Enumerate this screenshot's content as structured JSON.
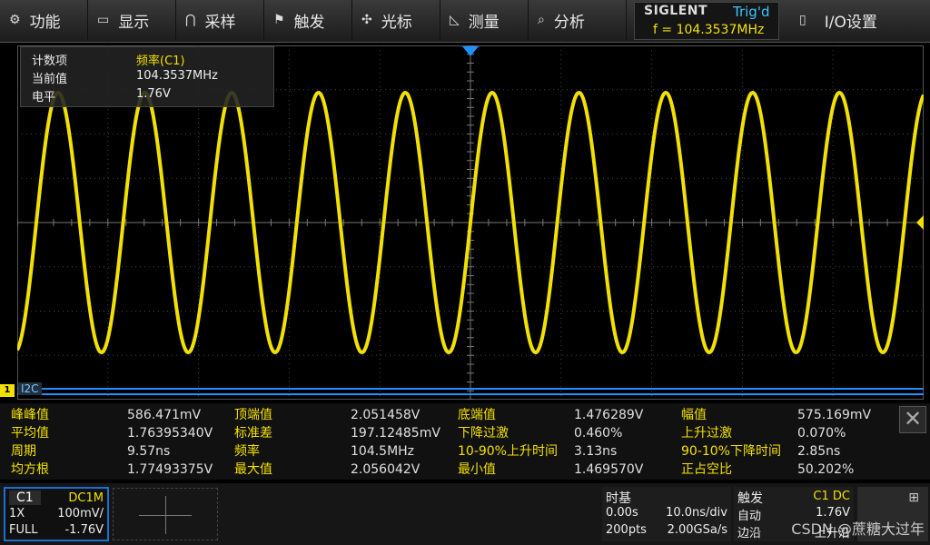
{
  "menu": {
    "func": "功能",
    "display": "显示",
    "acquire": "采样",
    "trigger": "触发",
    "cursor": "光标",
    "measure": "测量",
    "analysis": "分析",
    "io": "I/O设置"
  },
  "brand": {
    "logo": "SIGLENT",
    "trig_status": "Trig'd",
    "freq": "f = 104.3537MHz"
  },
  "counter": {
    "label1": "计数项",
    "value1": "频率(C1)",
    "label2": "当前值",
    "value2": "104.3537MHz",
    "label3": "电平",
    "value3": "1.76V"
  },
  "channel_marker": "1",
  "bus_label": "I2C",
  "measurements": [
    [
      "峰峰值",
      "586.471mV",
      "顶端值",
      "2.051458V",
      "底端值",
      "1.476289V",
      "幅值",
      "575.169mV"
    ],
    [
      "平均值",
      "1.76395340V",
      "标准差",
      "197.12485mV",
      "下降过激",
      "0.460%",
      "上升过激",
      "0.070%"
    ],
    [
      "周期",
      "9.57ns",
      "频率",
      "104.5MHz",
      "10-90%上升时间",
      "3.13ns",
      "90-10%下降时间",
      "2.85ns"
    ],
    [
      "均方根",
      "1.77493375V",
      "最大值",
      "2.056042V",
      "最小值",
      "1.469570V",
      "正占空比",
      "50.202%"
    ]
  ],
  "channel": {
    "name": "C1",
    "coupling": "DC1M",
    "probe": "1X",
    "scale": "100mV/",
    "bw": "FULL",
    "offset": "-1.76V"
  },
  "timebase": {
    "title": "时基",
    "delay": "0.00s",
    "scale": "10.0ns/div",
    "points": "200pts",
    "rate": "2.00GSa/s"
  },
  "trigger": {
    "title": "触发",
    "source": "C1 DC",
    "mode": "自动",
    "level": "1.76V",
    "type": "边沿",
    "slope": "上升沿"
  },
  "watermark": "CSDN @蔗糖大过年",
  "colors": {
    "trace": "#f2e100",
    "accent": "#3ac4ff",
    "bus": "#1e90ff"
  }
}
